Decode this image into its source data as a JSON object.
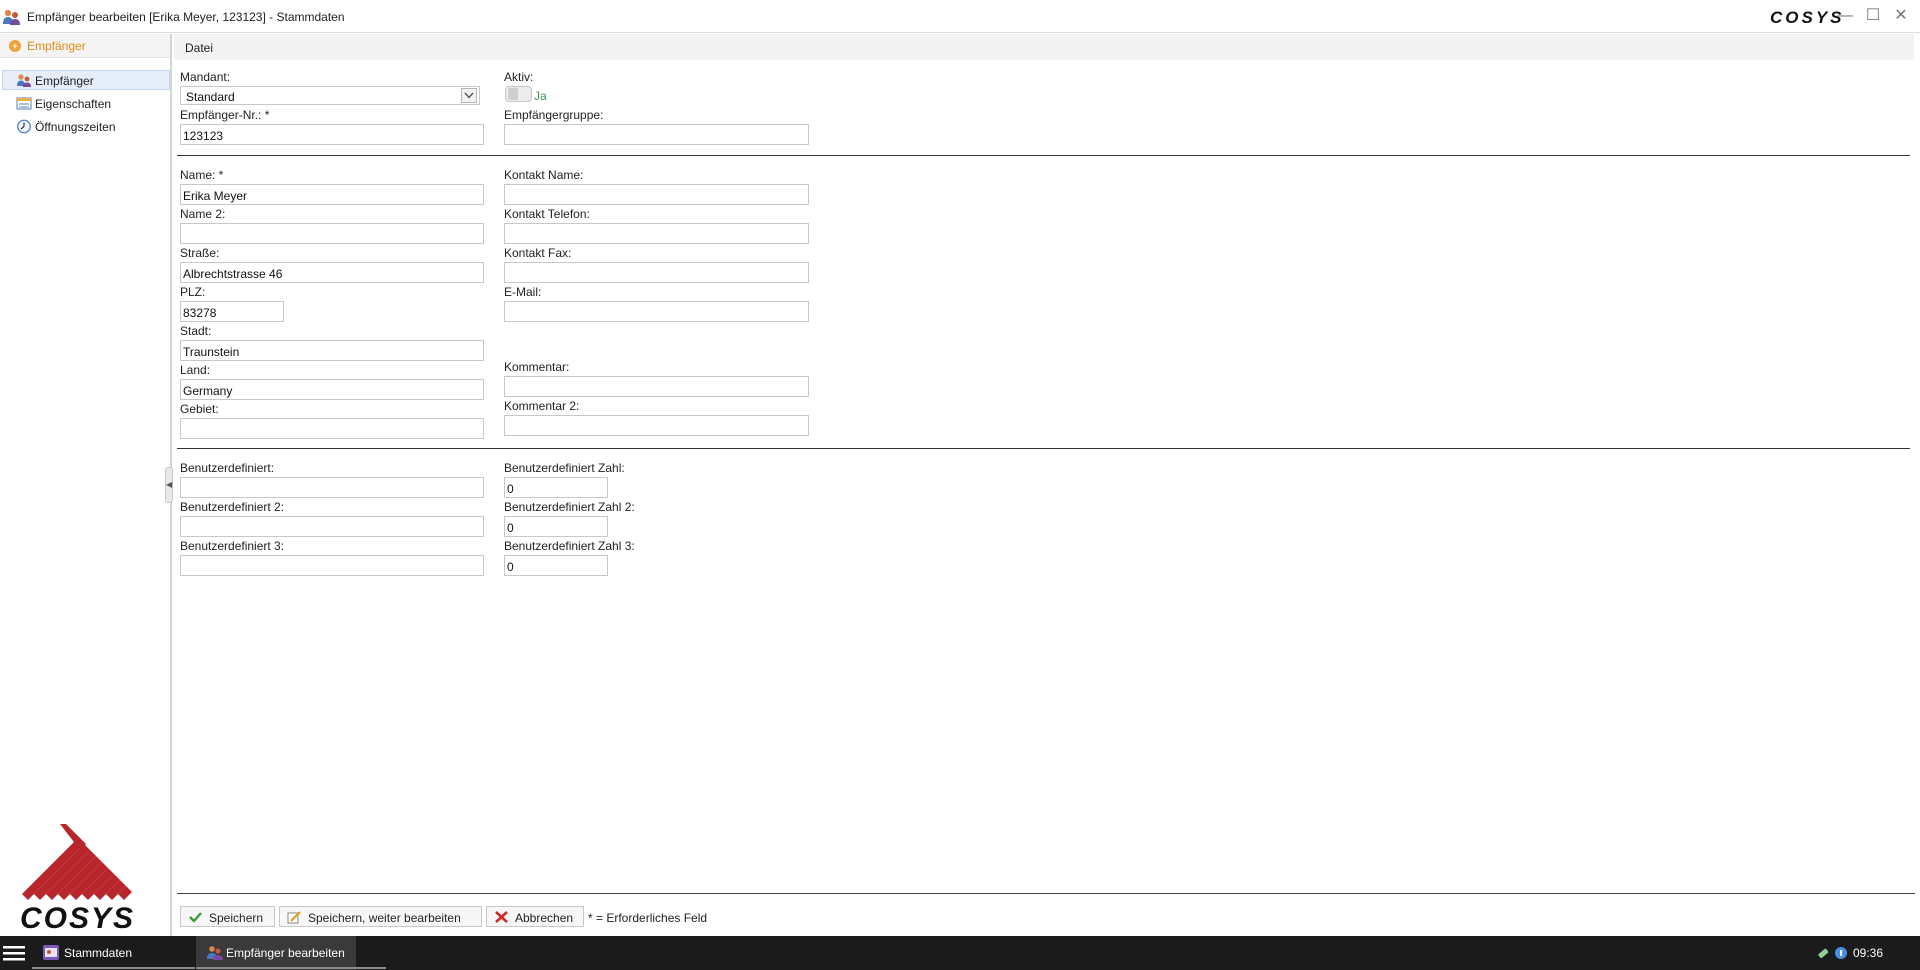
{
  "window": {
    "title": "Empfänger bearbeiten [Erika Meyer, 123123] - Stammdaten",
    "brand": "COSYS",
    "controls": {
      "minimize": "—",
      "maximize": "☐",
      "close": "✕"
    }
  },
  "sidebar": {
    "header": "Empfänger",
    "items": [
      {
        "label": "Empfänger",
        "icon": "recipient-icon",
        "active": true
      },
      {
        "label": "Eigenschaften",
        "icon": "properties-icon",
        "active": false
      },
      {
        "label": "Öffnungszeiten",
        "icon": "clock-icon",
        "active": false
      }
    ],
    "collapse_glyph": "◀"
  },
  "menu": {
    "items": [
      "Datei"
    ]
  },
  "form": {
    "mandant": {
      "label": "Mandant:",
      "value": "Standard"
    },
    "aktiv": {
      "label": "Aktiv:",
      "value": "Ja"
    },
    "empfaenger_nr": {
      "label": "Empfänger-Nr.: *",
      "value": "123123"
    },
    "empfaengergruppe": {
      "label": "Empfängergruppe:",
      "value": ""
    },
    "name": {
      "label": "Name: *",
      "value": "Erika Meyer"
    },
    "name2": {
      "label": "Name 2:",
      "value": ""
    },
    "strasse": {
      "label": "Straße:",
      "value": "Albrechtstrasse 46"
    },
    "plz": {
      "label": "PLZ:",
      "value": "83278"
    },
    "stadt": {
      "label": "Stadt:",
      "value": "Traunstein"
    },
    "land": {
      "label": "Land:",
      "value": "Germany"
    },
    "gebiet": {
      "label": "Gebiet:",
      "value": ""
    },
    "kontakt_name": {
      "label": "Kontakt Name:",
      "value": ""
    },
    "kontakt_telefon": {
      "label": "Kontakt Telefon:",
      "value": ""
    },
    "kontakt_fax": {
      "label": "Kontakt Fax:",
      "value": ""
    },
    "email": {
      "label": "E-Mail:",
      "value": ""
    },
    "kommentar": {
      "label": "Kommentar:",
      "value": ""
    },
    "kommentar2": {
      "label": "Kommentar 2:",
      "value": ""
    },
    "benutzerdefiniert": {
      "label": "Benutzerdefiniert:",
      "value": ""
    },
    "benutzerdefiniert2": {
      "label": "Benutzerdefiniert 2:",
      "value": ""
    },
    "benutzerdefiniert3": {
      "label": "Benutzerdefiniert 3:",
      "value": ""
    },
    "zahl1": {
      "label": "Benutzerdefiniert Zahl:",
      "value": "0"
    },
    "zahl2": {
      "label": "Benutzerdefiniert Zahl 2:",
      "value": "0"
    },
    "zahl3": {
      "label": "Benutzerdefiniert Zahl 3:",
      "value": "0"
    }
  },
  "footer": {
    "save_label": "Speichern",
    "save_continue_label": "Speichern, weiter bearbeiten",
    "cancel_label": "Abbrechen",
    "required_note": "* = Erforderliches Feld"
  },
  "taskbar": {
    "tasks": [
      {
        "label": "Stammdaten",
        "active": false
      },
      {
        "label": "Empfänger bearbeiten",
        "active": true
      }
    ],
    "clock": "09:36"
  },
  "colors": {
    "accent_orange": "#e08a14",
    "toggle_green": "#3f9a52",
    "brand_red": "#b8262b",
    "taskbar_bg": "#1b1b1b"
  }
}
